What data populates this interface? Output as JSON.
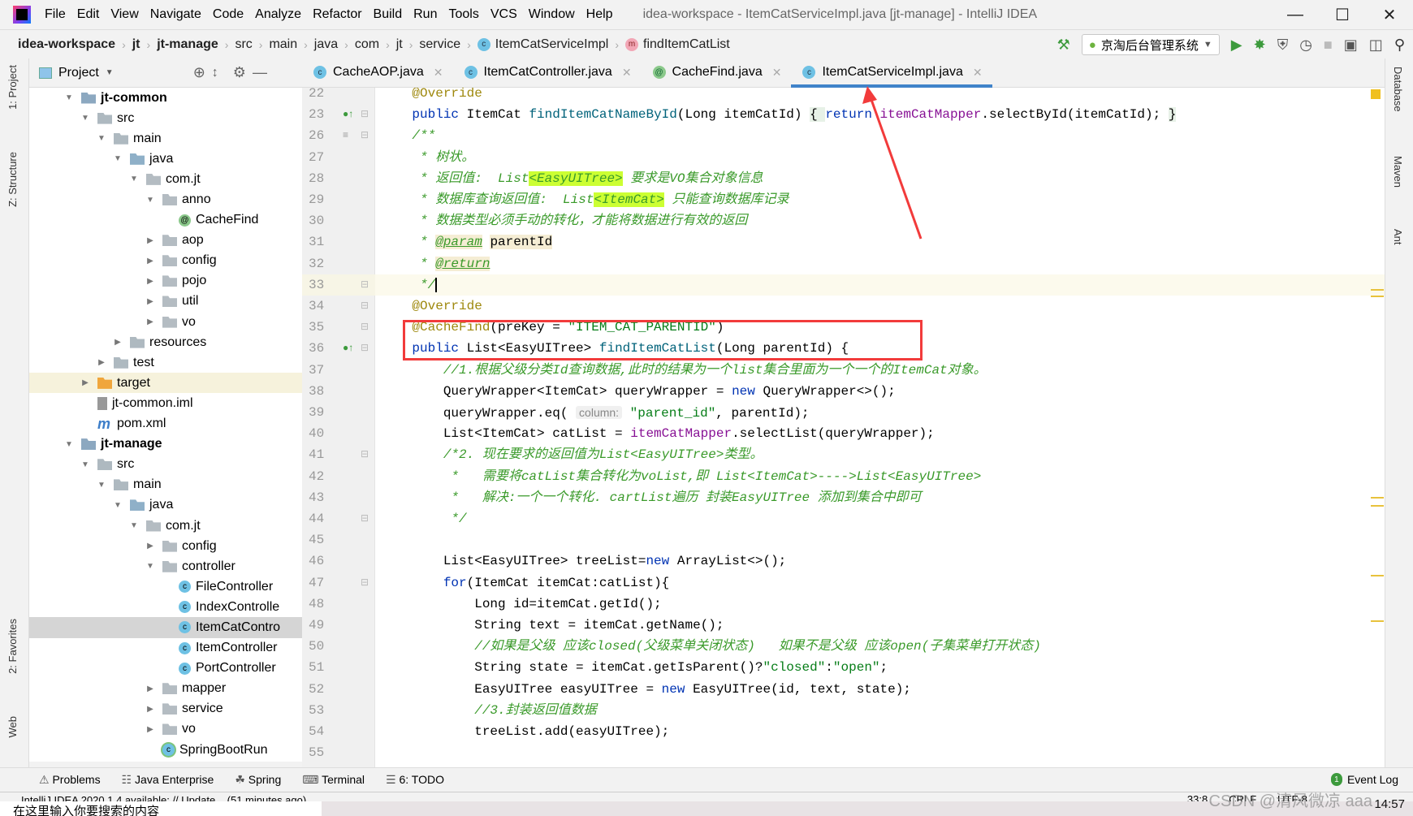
{
  "menubar": {
    "items": [
      "File",
      "Edit",
      "View",
      "Navigate",
      "Code",
      "Analyze",
      "Refactor",
      "Build",
      "Run",
      "Tools",
      "VCS",
      "Window",
      "Help"
    ],
    "title": "idea-workspace - ItemCatServiceImpl.java [jt-manage] - IntelliJ IDEA"
  },
  "breadcrumb": [
    "idea-workspace",
    "jt",
    "jt-manage",
    "src",
    "main",
    "java",
    "com",
    "jt",
    "service",
    "ItemCatServiceImpl",
    "findItemCatList"
  ],
  "toolbar": {
    "run_config": "京淘后台管理系统",
    "icons": [
      "build-hammer-icon",
      "run-icon",
      "debug-icon",
      "coverage-icon",
      "profile-icon",
      "stop-icon",
      "project-structure-icon",
      "terminal-window-icon",
      "search-icon"
    ]
  },
  "left_strip": {
    "tabs": [
      "1: Project",
      "Z: Structure",
      "2: Favorites",
      "Web"
    ]
  },
  "project": {
    "title": "Project",
    "tree": [
      {
        "d": 0,
        "a": "open",
        "i": "module",
        "t": "jt-common",
        "b": true
      },
      {
        "d": 1,
        "a": "open",
        "i": "folder",
        "t": "src"
      },
      {
        "d": 2,
        "a": "open",
        "i": "folder",
        "t": "main"
      },
      {
        "d": 3,
        "a": "open",
        "i": "src",
        "t": "java"
      },
      {
        "d": 4,
        "a": "open",
        "i": "pkg",
        "t": "com.jt"
      },
      {
        "d": 5,
        "a": "open",
        "i": "pkg",
        "t": "anno"
      },
      {
        "d": 6,
        "a": "",
        "i": "ann",
        "t": "CacheFind"
      },
      {
        "d": 5,
        "a": "closed",
        "i": "pkg",
        "t": "aop"
      },
      {
        "d": 5,
        "a": "closed",
        "i": "pkg",
        "t": "config"
      },
      {
        "d": 5,
        "a": "closed",
        "i": "pkg",
        "t": "pojo"
      },
      {
        "d": 5,
        "a": "closed",
        "i": "pkg",
        "t": "util"
      },
      {
        "d": 5,
        "a": "closed",
        "i": "pkg",
        "t": "vo"
      },
      {
        "d": 3,
        "a": "closed",
        "i": "folder",
        "t": "resources"
      },
      {
        "d": 2,
        "a": "closed",
        "i": "folder",
        "t": "test"
      },
      {
        "d": 1,
        "a": "closed",
        "i": "orange",
        "t": "target",
        "hl": true
      },
      {
        "d": 1,
        "a": "",
        "i": "iml",
        "t": "jt-common.iml"
      },
      {
        "d": 1,
        "a": "",
        "i": "pom",
        "t": "pom.xml"
      },
      {
        "d": 0,
        "a": "open",
        "i": "module",
        "t": "jt-manage",
        "b": true
      },
      {
        "d": 1,
        "a": "open",
        "i": "folder",
        "t": "src"
      },
      {
        "d": 2,
        "a": "open",
        "i": "folder",
        "t": "main"
      },
      {
        "d": 3,
        "a": "open",
        "i": "src",
        "t": "java"
      },
      {
        "d": 4,
        "a": "open",
        "i": "pkg",
        "t": "com.jt"
      },
      {
        "d": 5,
        "a": "closed",
        "i": "pkg",
        "t": "config"
      },
      {
        "d": 5,
        "a": "open",
        "i": "pkg",
        "t": "controller"
      },
      {
        "d": 6,
        "a": "",
        "i": "class",
        "t": "FileController"
      },
      {
        "d": 6,
        "a": "",
        "i": "class",
        "t": "IndexControlle"
      },
      {
        "d": 6,
        "a": "",
        "i": "class",
        "t": "ItemCatContro",
        "sel": true
      },
      {
        "d": 6,
        "a": "",
        "i": "class",
        "t": "ItemController"
      },
      {
        "d": 6,
        "a": "",
        "i": "class",
        "t": "PortController"
      },
      {
        "d": 5,
        "a": "closed",
        "i": "pkg",
        "t": "mapper"
      },
      {
        "d": 5,
        "a": "closed",
        "i": "pkg",
        "t": "service"
      },
      {
        "d": 5,
        "a": "closed",
        "i": "pkg",
        "t": "vo"
      },
      {
        "d": 5,
        "a": "",
        "i": "boot",
        "t": "SpringBootRun"
      }
    ]
  },
  "tabs": [
    {
      "label": "CacheAOP.java",
      "icon": "class",
      "active": false
    },
    {
      "label": "ItemCatController.java",
      "icon": "class",
      "active": false
    },
    {
      "label": "CacheFind.java",
      "icon": "ann",
      "active": false
    },
    {
      "label": "ItemCatServiceImpl.java",
      "icon": "class",
      "active": true
    }
  ],
  "editor": {
    "current_line": "33",
    "lines": [
      {
        "n": "22",
        "t": [
          [
            "ann",
            "    @Override"
          ]
        ]
      },
      {
        "n": "23",
        "g": "impl",
        "t": [
          [
            "kw",
            "    public "
          ],
          [
            "",
            "ItemCat "
          ],
          [
            "fn",
            "findItemCatNameById"
          ],
          [
            "",
            "(Long itemCatId) "
          ],
          [
            "fold",
            "{ "
          ],
          [
            "kw",
            "return "
          ],
          [
            "fld",
            "itemCatMapper"
          ],
          [
            "",
            ".selectById(itemCatId); "
          ],
          [
            "fold",
            "}"
          ]
        ]
      },
      {
        "n": "26",
        "g": "doc",
        "t": [
          [
            "cm",
            "    /**"
          ]
        ]
      },
      {
        "n": "27",
        "t": [
          [
            "cm",
            "     * 树状。"
          ]
        ]
      },
      {
        "n": "28",
        "t": [
          [
            "cm",
            "     * 返回值:  List"
          ],
          [
            "cm hl",
            "<EasyUITree>"
          ],
          [
            "cm",
            " 要求是VO集合对象信息"
          ]
        ]
      },
      {
        "n": "29",
        "t": [
          [
            "cm",
            "     * 数据库查询返回值:  List"
          ],
          [
            "cm hl",
            "<ItemCat>"
          ],
          [
            "cm",
            " 只能查询数据库记录"
          ]
        ]
      },
      {
        "n": "30",
        "t": [
          [
            "cm",
            "     * 数据类型必须手动的转化，才能将数据进行有效的返回"
          ]
        ]
      },
      {
        "n": "31",
        "t": [
          [
            "cm",
            "     * "
          ],
          [
            "cm tagu",
            "@param"
          ],
          [
            "cm",
            " "
          ],
          [
            "ptag",
            "parentId"
          ]
        ]
      },
      {
        "n": "32",
        "t": [
          [
            "cm",
            "     * "
          ],
          [
            "cm tagu",
            "@return"
          ]
        ]
      },
      {
        "n": "33",
        "t": [
          [
            "cm",
            "     */"
          ]
        ]
      },
      {
        "n": "34",
        "t": [
          [
            "ann",
            "    @Override"
          ]
        ]
      },
      {
        "n": "35",
        "t": [
          [
            "ann",
            "    @CacheFind"
          ],
          [
            "",
            "(preKey = "
          ],
          [
            "str",
            "\"ITEM_CAT_PARENTID\""
          ],
          [
            "",
            ")"
          ]
        ]
      },
      {
        "n": "36",
        "g": "impl",
        "t": [
          [
            "kw",
            "    public "
          ],
          [
            "",
            "List<EasyUITree> "
          ],
          [
            "fn",
            "findItemCatList"
          ],
          [
            "",
            "(Long parentId) {"
          ]
        ]
      },
      {
        "n": "37",
        "t": [
          [
            "cm",
            "        //1.根据父级分类Id查询数据,此时的结果为一个list集合里面为一个一个的ItemCat对象。"
          ]
        ]
      },
      {
        "n": "38",
        "t": [
          [
            "",
            "        QueryWrapper<ItemCat> queryWrapper = "
          ],
          [
            "kw",
            "new "
          ],
          [
            "",
            "QueryWrapper<>();"
          ]
        ]
      },
      {
        "n": "39",
        "t": [
          [
            "",
            "        queryWrapper.eq( "
          ],
          [
            "hint",
            "column:"
          ],
          [
            "str",
            " \"parent_id\""
          ],
          [
            "",
            ", parentId);"
          ]
        ]
      },
      {
        "n": "40",
        "t": [
          [
            "",
            "        List<ItemCat> catList = "
          ],
          [
            "fld",
            "itemCatMapper"
          ],
          [
            "",
            ".selectList(queryWrapper);"
          ]
        ]
      },
      {
        "n": "41",
        "t": [
          [
            "cm",
            "        /*2. 现在要求的返回值为List<EasyUITree>类型。"
          ]
        ]
      },
      {
        "n": "42",
        "t": [
          [
            "cm",
            "         *   需要将catList集合转化为voList,即 List<ItemCat>---->List<EasyUITree>"
          ]
        ]
      },
      {
        "n": "43",
        "t": [
          [
            "cm",
            "         *   解决:一个一个转化. cartList遍历 封装EasyUITree 添加到集合中即可"
          ]
        ]
      },
      {
        "n": "44",
        "t": [
          [
            "cm",
            "         */"
          ]
        ]
      },
      {
        "n": "45",
        "t": [
          [
            "",
            ""
          ]
        ]
      },
      {
        "n": "46",
        "t": [
          [
            "",
            "        List<EasyUITree> treeList="
          ],
          [
            "kw",
            "new "
          ],
          [
            "",
            "ArrayList<>();"
          ]
        ]
      },
      {
        "n": "47",
        "t": [
          [
            "kw",
            "        for"
          ],
          [
            "",
            "(ItemCat itemCat:catList){"
          ]
        ]
      },
      {
        "n": "48",
        "t": [
          [
            "",
            "            Long id=itemCat.getId();"
          ]
        ]
      },
      {
        "n": "49",
        "t": [
          [
            "",
            "            String text = itemCat.getName();"
          ]
        ]
      },
      {
        "n": "50",
        "t": [
          [
            "cm",
            "            //如果是父级 应该closed(父级菜单关闭状态)   如果不是父级 应该open(子集菜单打开状态)"
          ]
        ]
      },
      {
        "n": "51",
        "t": [
          [
            "",
            "            String state = itemCat.getIsParent()?"
          ],
          [
            "str",
            "\"closed\""
          ],
          [
            "",
            ":"
          ],
          [
            "str",
            "\"open\""
          ],
          [
            "",
            ";"
          ]
        ]
      },
      {
        "n": "52",
        "t": [
          [
            "",
            "            EasyUITree easyUITree = "
          ],
          [
            "kw",
            "new "
          ],
          [
            "",
            "EasyUITree(id, text, state);"
          ]
        ]
      },
      {
        "n": "53",
        "t": [
          [
            "cm",
            "            //3.封装返回值数据"
          ]
        ]
      },
      {
        "n": "54",
        "t": [
          [
            "",
            "            treeList.add(easyUITree);"
          ]
        ]
      },
      {
        "n": "55",
        "t": [
          [
            "",
            ""
          ]
        ]
      }
    ]
  },
  "right_strip": {
    "tabs": [
      "Database",
      "Maven",
      "Ant"
    ]
  },
  "bottom_tools": [
    "Problems",
    "Java Enterprise",
    "Spring",
    "Terminal",
    "6: TODO"
  ],
  "event_log": {
    "label": "Event Log",
    "count": "1"
  },
  "status": {
    "message": "IntelliJ IDEA 2020.1.4 available: // Update... (51 minutes ago)",
    "position": "33:8",
    "line_sep": "CRLF",
    "encoding": "UTF-8"
  },
  "taskbar": {
    "search_placeholder": "在这里输入你要搜索的内容",
    "clock": "14:57"
  },
  "watermark": "CSDN @清风微凉 aaa",
  "colors": {
    "keyword": "#0033b3",
    "string": "#067d17",
    "comment": "#3a9a2a",
    "annotation": "#9e880d",
    "annotation_box": "#f23b3b",
    "active_tab": "#4083c9"
  }
}
